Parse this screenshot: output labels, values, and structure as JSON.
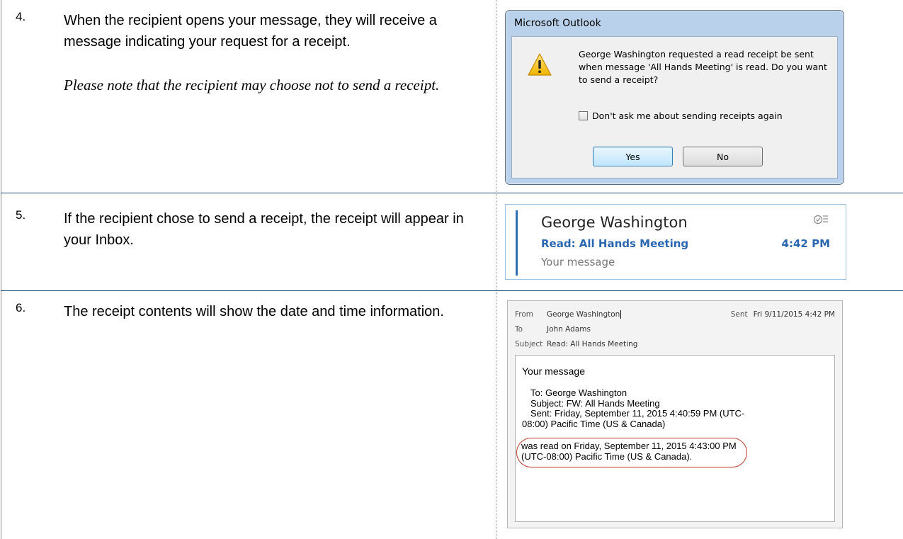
{
  "steps": [
    {
      "num": "4.",
      "text": "When the recipient opens your message, they will receive a message indicating your request for a receipt.",
      "note": "Please note that the recipient may choose not to send a receipt."
    },
    {
      "num": "5.",
      "text": "If the recipient chose to send a receipt, the receipt will appear in your Inbox."
    },
    {
      "num": "6.",
      "text": "The receipt contents will show the date and time information."
    }
  ],
  "dialog": {
    "title": "Microsoft Outlook",
    "message": "George Washington requested a read receipt be sent when message 'All Hands Meeting' is read. Do you want to send a receipt?",
    "checkbox_label": "Don't ask me about sending receipts again",
    "checkbox_checked": false,
    "yes_label": "Yes",
    "no_label": "No",
    "icon": "warning-icon"
  },
  "inbox_item": {
    "sender": "George Washington",
    "subject": "Read: All Hands Meeting",
    "time": "4:42 PM",
    "preview": "Your message",
    "icon": "read-flag-icon",
    "accent_color": "#2b66b0"
  },
  "receipt": {
    "from_label": "From",
    "from_value": "George Washington",
    "sent_label": "Sent",
    "sent_value": "Fri 9/11/2015 4:42 PM",
    "to_label": "To",
    "to_value": "John Adams",
    "subject_label": "Subject",
    "subject_value": "Read: All Hands Meeting",
    "body_title": "Your message",
    "detail_to": "To: George Washington",
    "detail_subject": "Subject: FW: All Hands Meeting",
    "detail_sent_1": "Sent: Friday, September 11, 2015 4:40:59 PM (UTC-",
    "detail_sent_2": "08:00) Pacific Time (US & Canada)",
    "read_line_1": "was read on Friday, September 11, 2015 4:43:00 PM",
    "read_line_2": "(UTC-08:00) Pacific Time (US & Canada).",
    "highlight_color": "#c0392b"
  }
}
